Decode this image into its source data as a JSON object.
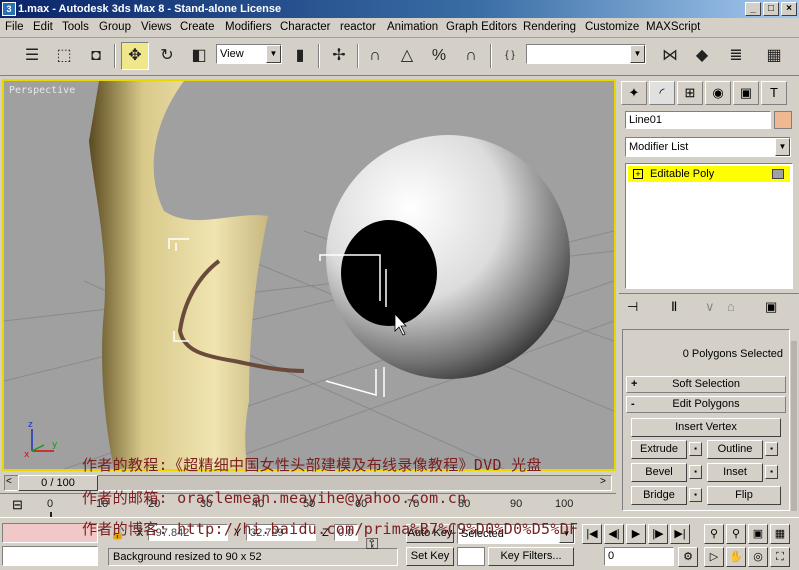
{
  "window": {
    "title": "1.max - Autodesk 3ds Max 8 - Stand-alone License",
    "controls": [
      "_",
      "□",
      "×"
    ]
  },
  "menu": [
    "File",
    "Edit",
    "Tools",
    "Group",
    "Views",
    "Create",
    "Modifiers",
    "Character",
    "reactor",
    "Animation",
    "Graph Editors",
    "Rendering",
    "Customize",
    "MAXScript"
  ],
  "toolbar": {
    "reference_coord": "View",
    "named_selection": ""
  },
  "viewport": {
    "label": "Perspective",
    "colors": {
      "border": "#e8d800",
      "background": "#a0a0a0"
    }
  },
  "command_panel": {
    "object_name": "Line01",
    "object_color": "#f0b890",
    "modifier_list": "Modifier List",
    "stack_item": "Editable Poly",
    "selection_info": "0 Polygons Selected",
    "rollouts": {
      "soft": "Soft Selection",
      "edit": "Edit Polygons"
    },
    "buttons": {
      "insert_vertex": "Insert Vertex",
      "extrude": "Extrude",
      "outline": "Outline",
      "bevel": "Bevel",
      "inset": "Inset",
      "bridge": "Bridge",
      "flip": "Flip"
    }
  },
  "time": {
    "slider": "0 / 100",
    "ticks": [
      "0",
      "10",
      "20",
      "30",
      "40",
      "50",
      "60",
      "70",
      "80",
      "90",
      "100"
    ]
  },
  "status": {
    "prompt": "Background resized to 90 x 52",
    "x": "-97.842",
    "y": "32.729",
    "z": "0.0",
    "auto_key": "Auto Key",
    "set_key": "Set Key",
    "selected": "Selected",
    "key_filters": "Key Filters...",
    "frame": "0"
  },
  "overlay_text": {
    "line1": "作者的教程:《超精细中国女性头部建模及布线录像教程》DVD 光盘",
    "line2": "作者的邮箱: oraclemean.meayihe@yahoo.com.cn",
    "line3": "作者的博客: http://hi.baidu.com/prima%B7%C9%D0%D0%D5%DF"
  }
}
